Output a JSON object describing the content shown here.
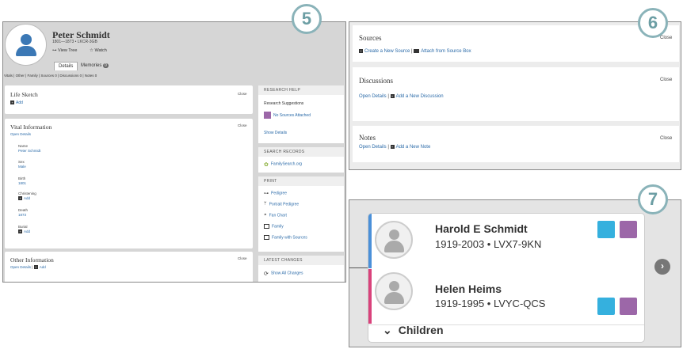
{
  "badges": {
    "p5": "5",
    "p6": "6",
    "p7": "7"
  },
  "p5": {
    "name": "Peter Schmidt",
    "dates": "1801—1873 • LKCR-3GB",
    "view_tree": "View Tree",
    "watch": "Watch",
    "tabs": {
      "details": "Details",
      "memories": "Memories",
      "memories_count": "0"
    },
    "subnav": "Vitals  |  Other  |  Family  |  Sources  0  |  Discussions  0  |  Notes  0",
    "life_sketch": {
      "title": "Life Sketch",
      "add": "Add",
      "close": "Close"
    },
    "vital": {
      "title": "Vital Information",
      "open_details": "Open Details",
      "close": "Close",
      "name_label": "Name",
      "name_value": "Peter Schmidt",
      "sex_label": "Sex",
      "sex_value": "Male",
      "birth_label": "Birth",
      "birth_value": "1801",
      "christening_label": "Christening",
      "christening_value": "Add",
      "death_label": "Death",
      "death_value": "1873",
      "burial_label": "Burial",
      "burial_value": "Add"
    },
    "other": {
      "title": "Other Information",
      "open_details": "Open Details",
      "add": "Add",
      "close": "Close"
    },
    "research_help": {
      "header": "RESEARCH HELP",
      "suggestions": "Research Suggestions",
      "no_sources": "No Sources Attached",
      "show_details": "Show Details"
    },
    "search_records": {
      "header": "SEARCH RECORDS",
      "familysearch": "FamilySearch.org"
    },
    "print": {
      "header": "PRINT",
      "items": [
        "Pedigree",
        "Portrait Pedigree",
        "Fan Chart",
        "Family",
        "Family with Sources"
      ]
    },
    "latest": {
      "header": "LATEST CHANGES",
      "show_all": "Show All Changes"
    }
  },
  "p6": {
    "sources": {
      "title": "Sources",
      "create": "Create a New Source",
      "attach": "Attach from Source Box",
      "close": "Close"
    },
    "discussions": {
      "title": "Discussions",
      "open_details": "Open Details",
      "add": "Add a New Discussion",
      "close": "Close"
    },
    "notes": {
      "title": "Notes",
      "open_details": "Open Details",
      "add": "Add a New Note",
      "close": "Close"
    }
  },
  "p7": {
    "people": [
      {
        "name": "Harold E Schmidt",
        "dates": "1919-2003 • LVX7-9KN",
        "bar_color": "#4a90d9"
      },
      {
        "name": "Helen Heims",
        "dates": "1919-1995 • LVYC-QCS",
        "bar_color": "#d9427b"
      }
    ],
    "children": "Children",
    "next_arrow": "›"
  },
  "colors": {
    "link": "#2a6aa8",
    "badge_ring": "#8ab3b9",
    "record_icon": "#35b0de",
    "tree_icon": "#9c67a8"
  }
}
